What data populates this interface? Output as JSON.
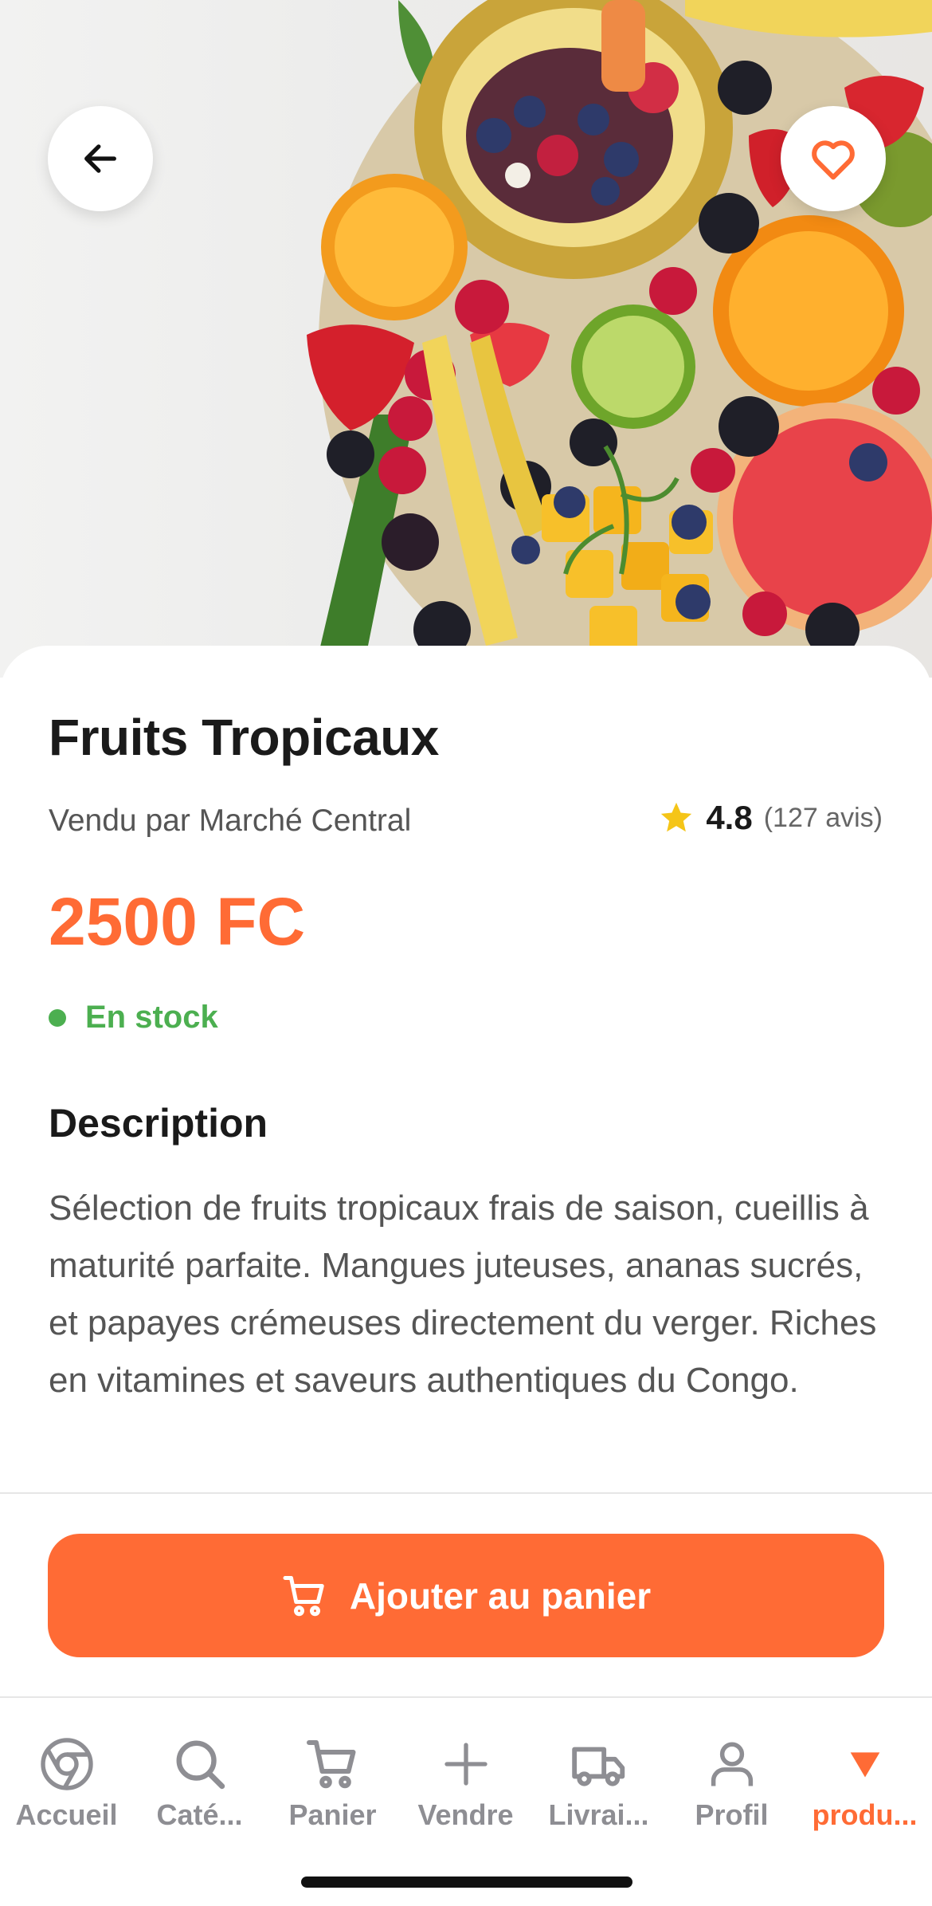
{
  "product": {
    "title": "Fruits Tropicaux",
    "seller": "Vendu par Marché Central",
    "rating": "4.8",
    "reviews": "(127 avis)",
    "price": "2500 FC",
    "stock": "En stock",
    "description_title": "Description",
    "description": "Sélection de fruits tropicaux frais de saison, cueillis à maturité parfaite. Mangues juteuses, ananas sucrés, et papayes crémeuses directement du verger. Riches en vitamines et saveurs authentiques du Congo."
  },
  "actions": {
    "add_to_cart": "Ajouter au panier",
    "back_icon": "arrow-left-icon",
    "favorite_icon": "heart-icon"
  },
  "tabbar": {
    "items": [
      {
        "label": "Accueil",
        "icon": "chrome-icon"
      },
      {
        "label": "Caté...",
        "icon": "search-icon"
      },
      {
        "label": "Panier",
        "icon": "cart-icon"
      },
      {
        "label": "Vendre",
        "icon": "plus-icon"
      },
      {
        "label": "Livrai...",
        "icon": "truck-icon"
      },
      {
        "label": "Profil",
        "icon": "person-icon"
      },
      {
        "label": "produ...",
        "icon": "triangle-down-icon",
        "active": true
      }
    ]
  },
  "colors": {
    "accent": "#ff6b35",
    "stock": "#4caf50",
    "star": "#f5c518",
    "tab_inactive": "#8e8e93"
  }
}
